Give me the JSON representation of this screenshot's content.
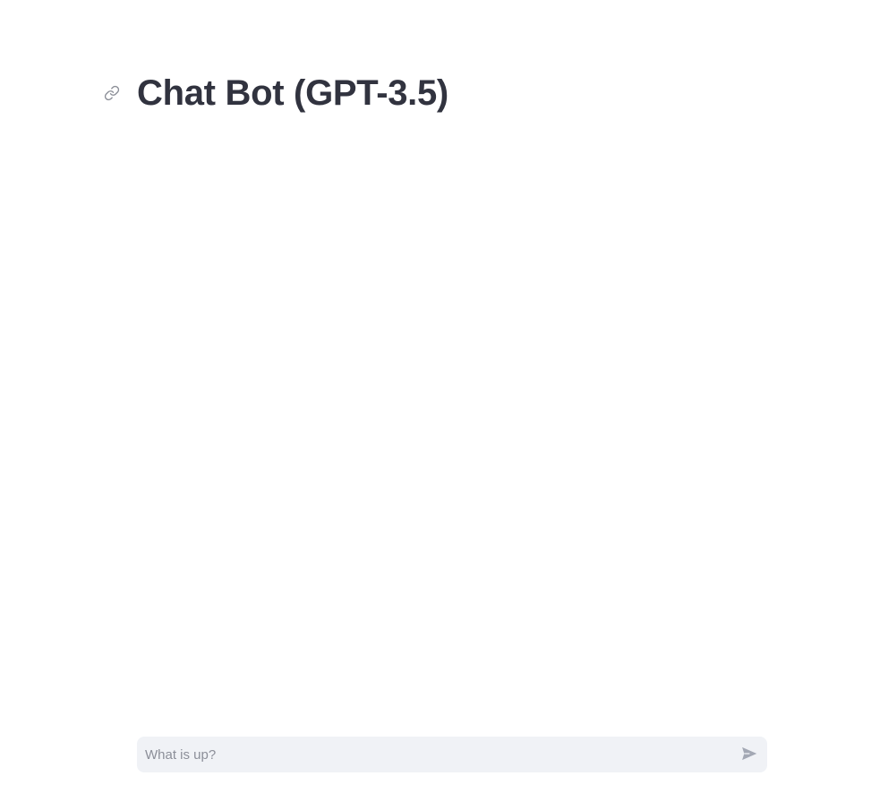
{
  "header": {
    "title": "Chat Bot (GPT-3.5)",
    "anchor_icon": "link-icon"
  },
  "chat": {
    "placeholder": "What is up?",
    "value": "",
    "send_icon": "send-icon"
  },
  "colors": {
    "text": "#31333f",
    "input_background": "#f0f2f6",
    "placeholder": "#8c8f99",
    "icon": "#a3a8b4"
  }
}
